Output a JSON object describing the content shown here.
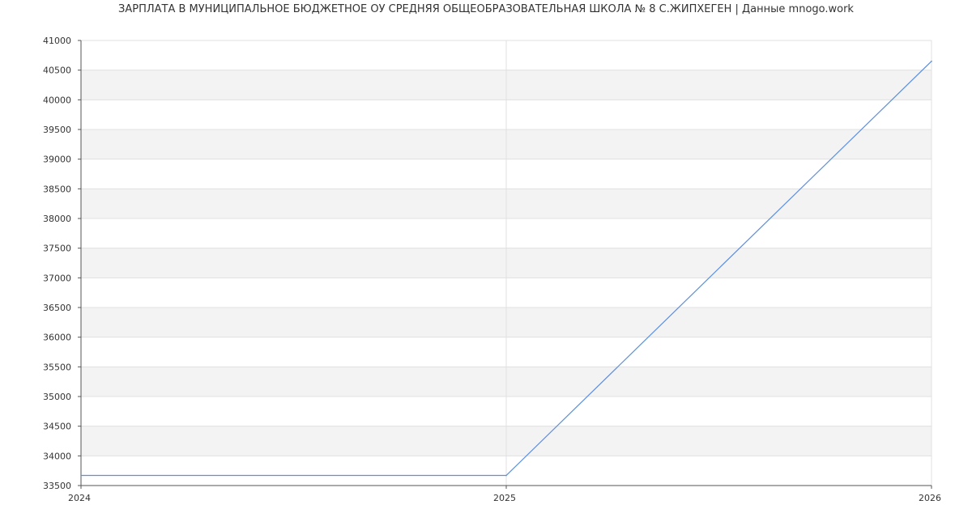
{
  "chart_data": {
    "type": "line",
    "title": "ЗАРПЛАТА В МУНИЦИПАЛЬНОЕ БЮДЖЕТНОЕ ОУ СРЕДНЯЯ ОБЩЕОБРАЗОВАТЕЛЬНАЯ ШКОЛА № 8 С.ЖИПХЕГЕН | Данные mnogo.work",
    "xlabel": "",
    "ylabel": "",
    "x_ticks": [
      "2024",
      "2025",
      "2026"
    ],
    "xlim": [
      2024,
      2026
    ],
    "ylim": [
      33500,
      41000
    ],
    "y_ticks": [
      "33500",
      "34000",
      "34500",
      "35000",
      "35500",
      "36000",
      "36500",
      "37000",
      "37500",
      "38000",
      "38500",
      "39000",
      "39500",
      "40000",
      "40500",
      "41000"
    ],
    "grid": true,
    "legend": "none",
    "series": [
      {
        "color": "#5b8fe0",
        "points": [
          {
            "x": 2024,
            "y": 33670
          },
          {
            "x": 2025,
            "y": 33670
          },
          {
            "x": 2026,
            "y": 40650
          }
        ]
      }
    ],
    "colors": {
      "band": "#f3f3f3",
      "grid": "#e0e0e0",
      "axis": "#555555"
    }
  }
}
